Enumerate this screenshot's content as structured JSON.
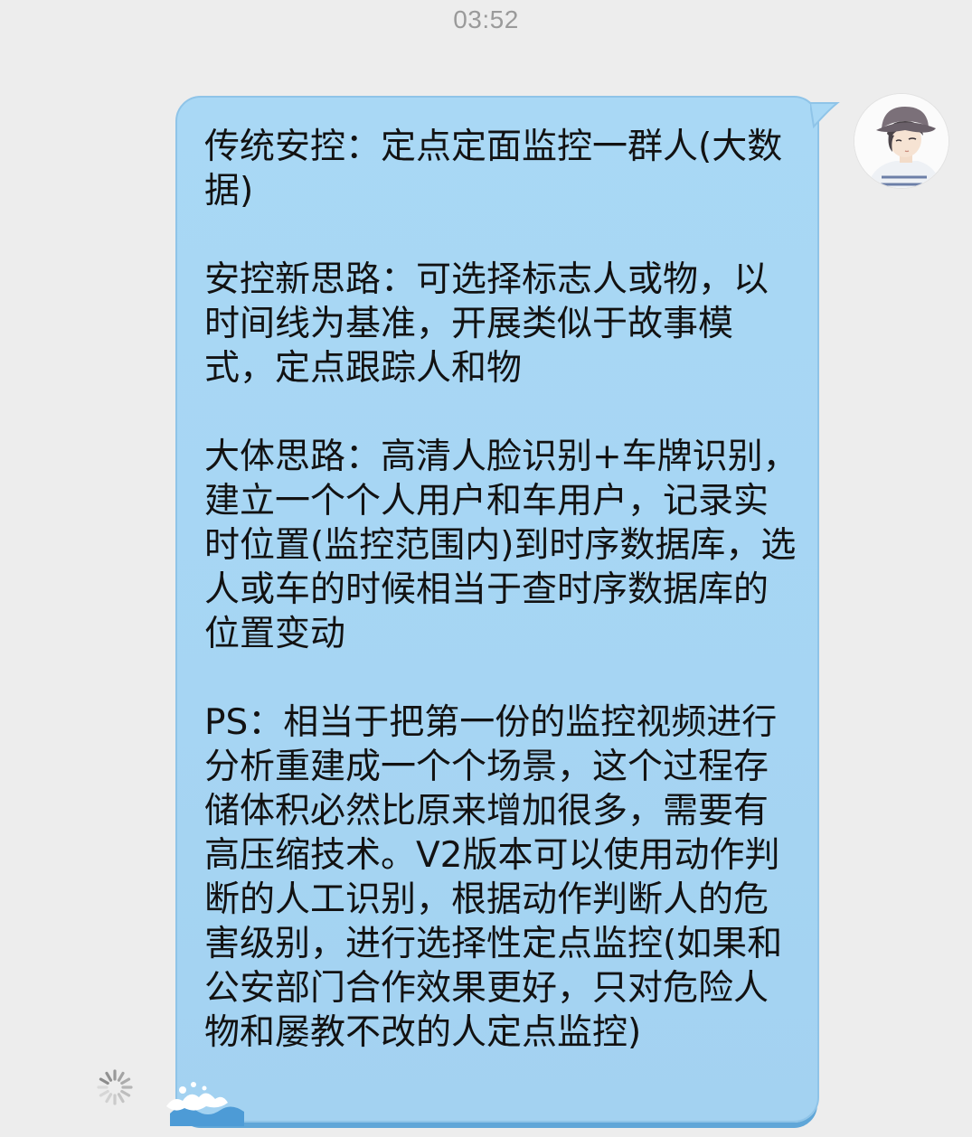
{
  "chat": {
    "timestamp": "03:52",
    "messages": [
      {
        "sender": "self",
        "avatar_icon": "avatar-boy-bucket-hat-icon",
        "status_icon": "loading-spinner-icon",
        "text": "传统安控：定点定面监控一群人(大数据)\n\n安控新思路：可选择标志人或物，以时间线为基准，开展类似于故事模式，定点跟踪人和物\n\n大体思路：高清人脸识别+车牌识别，建立一个个人用户和车用户，记录实时位置(监控范围内)到时序数据库，选人或车的时候相当于查时序数据库的位置变动\n\nPS：相当于把第一份的监控视频进行分析重建成一个个场景，这个过程存储体积必然比原来增加很多，需要有高压缩技术。V2版本可以使用动作判断的人工识别，根据动作判断人的危害级别，进行选择性定点监控(如果和公安部门合作效果更好，只对危险人物和屡教不改的人定点监控)"
      }
    ]
  },
  "colors": {
    "background": "#ededed",
    "bubble": "#a9d8f5",
    "bubble_border": "#8fc4e8",
    "text": "#121212",
    "timestamp": "#9a9a9a"
  }
}
